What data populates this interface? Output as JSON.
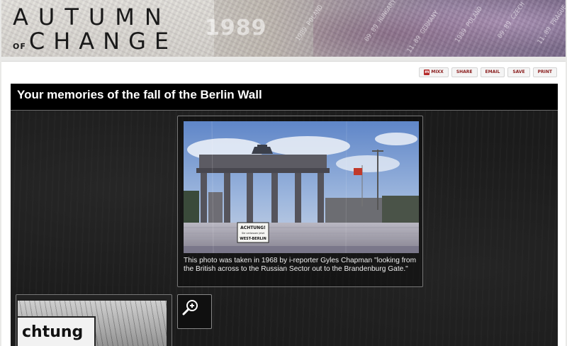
{
  "banner": {
    "title_line1": "AUTUMN",
    "title_of": "OF",
    "title_line2": "CHANGE",
    "year": "1989",
    "stamps": [
      "1989 POLAND",
      "09.89 HUNGARY",
      "11.89 GERMANY",
      "1989 POLAND",
      "09.89 CZECH",
      "11.89 PRAGUE"
    ]
  },
  "share": {
    "mixx": "MIXX",
    "share": "SHARE",
    "email": "EMAIL",
    "save": "SAVE",
    "print": "PRINT"
  },
  "panel": {
    "title": "Your memories of the fall of the Berlin Wall"
  },
  "photo": {
    "sign_line1": "ACHTUNG!",
    "sign_line2": "Sie verlassen jetzt",
    "sign_line3": "WEST-BERLIN",
    "caption": "This photo was taken in 1968 by i-reporter Gyles Chapman \"looking from the British across to the Russian Sector out to the Brandenburg Gate.\""
  },
  "thumbnail": {
    "sign_text": "chtung"
  },
  "colors": {
    "panel_bg": "#1b1b1b",
    "header_bg": "#000000",
    "share_text": "#8a1d1d",
    "mixx_icon": "#b52a2a",
    "page_bg": "#ffffff"
  },
  "icons": {
    "zoom": "zoom-in-icon"
  }
}
